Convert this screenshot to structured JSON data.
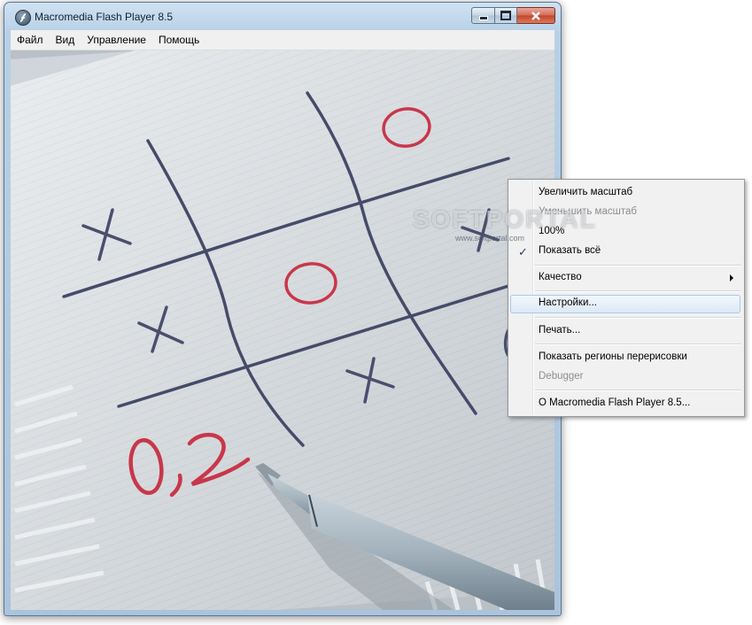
{
  "window": {
    "title": "Macromedia Flash Player 8.5",
    "icon": "flash-player-icon",
    "caption_buttons": [
      "minimize",
      "maximize",
      "close"
    ]
  },
  "menubar": {
    "items": [
      "Файл",
      "Вид",
      "Управление",
      "Помощь"
    ]
  },
  "game": {
    "board_marks": [
      "X",
      "O",
      "X",
      "O",
      "X",
      "X",
      "X",
      "O"
    ],
    "score_text": "0,2",
    "mark_colors": {
      "x": "#4a4f6e",
      "o": "#c8374a"
    }
  },
  "context_menu": {
    "items": [
      {
        "label": "Увеличить масштаб",
        "enabled": true
      },
      {
        "label": "Уменьшить масштаб",
        "enabled": false
      },
      {
        "label": "100%",
        "enabled": true
      },
      {
        "label": "Показать всё",
        "enabled": true,
        "checked": true
      },
      {
        "label": "Качество",
        "enabled": true,
        "submenu": true
      },
      {
        "label": "Настройки...",
        "enabled": true,
        "highlighted": true
      },
      {
        "label": "Печать...",
        "enabled": true
      },
      {
        "label": "Показать регионы перерисовки",
        "enabled": true
      },
      {
        "label": "Debugger",
        "enabled": false
      },
      {
        "label": "О Macromedia Flash Player 8.5...",
        "enabled": true
      }
    ]
  },
  "watermark": {
    "main": "SOFTPORTAL",
    "sub": "www.softportal.com"
  },
  "colors": {
    "accent_hover": "#dde9f6",
    "window_frame": "#b7d0e6"
  }
}
